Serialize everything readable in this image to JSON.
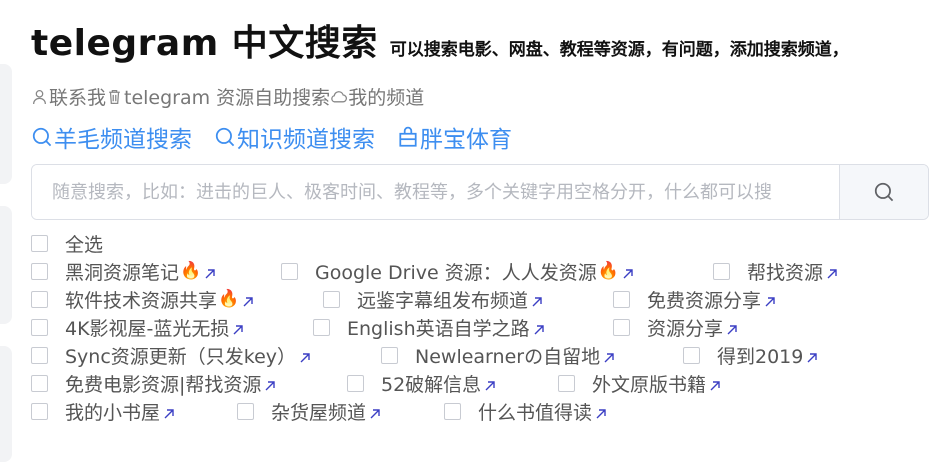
{
  "header": {
    "title": "telegram 中文搜索",
    "subtitle": "可以搜索电影、网盘、教程等资源，有问题，添加搜索频道，"
  },
  "top_links": [
    {
      "label": "联系我",
      "icon": "user-icon"
    },
    {
      "label": "telegram 资源自助搜索",
      "icon": "trash-icon"
    },
    {
      "label": "我的频道",
      "icon": "cloud-icon"
    }
  ],
  "channel_links": [
    {
      "label": "羊毛频道搜索",
      "icon": "search-icon"
    },
    {
      "label": "知识频道搜索",
      "icon": "search-icon"
    },
    {
      "label": "胖宝体育",
      "icon": "bag-icon"
    }
  ],
  "search": {
    "placeholder": "随意搜索，比如：进击的巨人、极客时间、教程等，多个关键字用空格分开，什么都可以搜",
    "value": ""
  },
  "select_all": {
    "label": "全选",
    "checked": false
  },
  "channels": [
    [
      {
        "label": "黑洞资源笔记",
        "fire": true
      },
      {
        "label": "Google Drive 资源：人人发资源",
        "fire": true
      },
      {
        "label": "帮找资源",
        "fire": false
      }
    ],
    [
      {
        "label": "软件技术资源共享",
        "fire": true
      },
      {
        "label": "远鉴字幕组发布频道",
        "fire": false
      },
      {
        "label": "免费资源分享",
        "fire": false
      }
    ],
    [
      {
        "label": "4K影视屋-蓝光无损",
        "fire": false
      },
      {
        "label": "English英语自学之路",
        "fire": false
      },
      {
        "label": "资源分享",
        "fire": false
      }
    ],
    [
      {
        "label": "Sync资源更新（只发key）",
        "fire": false
      },
      {
        "label": "Newlearnerの自留地",
        "fire": false
      },
      {
        "label": "得到2019",
        "fire": false
      }
    ],
    [
      {
        "label": "免费电影资源|帮找资源",
        "fire": false
      },
      {
        "label": "52破解信息",
        "fire": false
      },
      {
        "label": "外文原版书籍",
        "fire": false
      }
    ],
    [
      {
        "label": "我的小书屋",
        "fire": false
      },
      {
        "label": "杂货屋频道",
        "fire": false
      },
      {
        "label": "什么书值得读",
        "fire": false
      }
    ]
  ],
  "fire_glyph": "🔥",
  "colors": {
    "accent": "#3d8ef0",
    "arrow": "#3b3fc4",
    "title": "#111111",
    "muted": "#777777"
  }
}
